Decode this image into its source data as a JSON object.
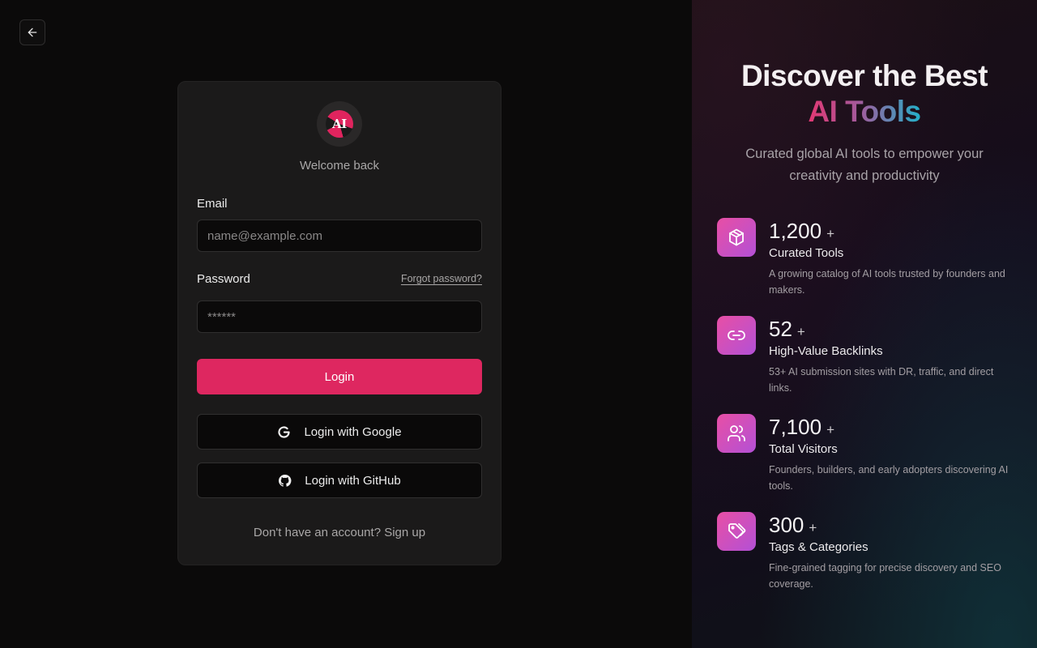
{
  "login": {
    "welcome": "Welcome back",
    "logo_text": "AI",
    "email_label": "Email",
    "email_placeholder": "name@example.com",
    "email_value": "",
    "password_label": "Password",
    "forgot_password": "Forgot password?",
    "password_placeholder": "******",
    "password_value": "",
    "login_button": "Login",
    "google_button": "Login with Google",
    "github_button": "Login with GitHub",
    "signup_prefix": "Don't have an account?",
    "signup_link": "Sign up"
  },
  "hero": {
    "title_line1": "Discover the Best",
    "title_line2": "AI Tools",
    "subtitle": "Curated global AI tools to empower your creativity and productivity"
  },
  "stats": [
    {
      "icon": "cube-icon",
      "value": "1,200",
      "plus": "+",
      "title": "Curated Tools",
      "desc": "A growing catalog of AI tools trusted by founders and makers."
    },
    {
      "icon": "link-icon",
      "value": "52",
      "plus": "+",
      "title": "High-Value Backlinks",
      "desc": "53+ AI submission sites with DR, traffic, and direct links."
    },
    {
      "icon": "users-icon",
      "value": "7,100",
      "plus": "+",
      "title": "Total Visitors",
      "desc": "Founders, builders, and early adopters discovering AI tools."
    },
    {
      "icon": "tags-icon",
      "value": "300",
      "plus": "+",
      "title": "Tags & Categories",
      "desc": "Fine-grained tagging for precise discovery and SEO coverage."
    }
  ],
  "colors": {
    "accent": "#de2760",
    "background": "#0b0a0a",
    "card": "#1b1a1a",
    "icon_gradient_start": "#e84fa5",
    "icon_gradient_end": "#b350d6"
  }
}
